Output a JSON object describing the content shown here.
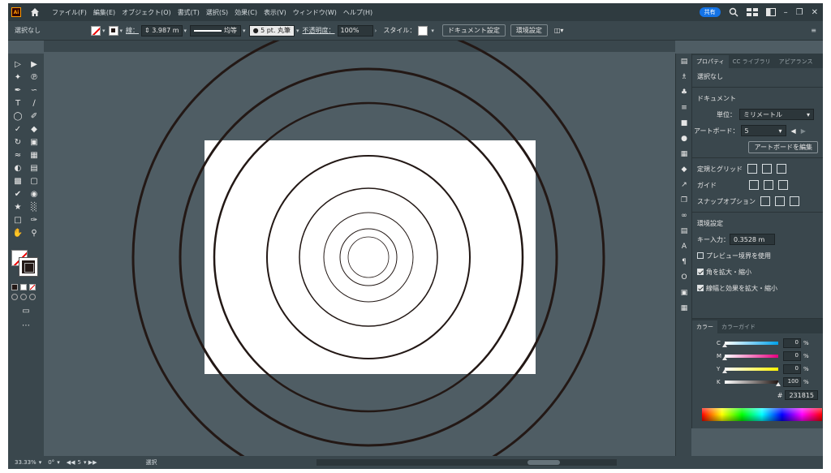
{
  "menubar": {
    "logo": "Ai",
    "items": [
      "ファイル(F)",
      "編集(E)",
      "オブジェクト(O)",
      "書式(T)",
      "選択(S)",
      "効果(C)",
      "表示(V)",
      "ウィンドウ(W)",
      "ヘルプ(H)"
    ],
    "share_label": "共有"
  },
  "controlbar": {
    "selection": "選択なし",
    "stroke_label": "線：",
    "stroke_weight": "3.987 m",
    "stroke_profile": "均等",
    "brush": "5 pt. 丸筆",
    "opacity_label": "不透明度：",
    "opacity": "100%",
    "style_label": "スタイル：",
    "doc_setup_button": "ドキュメント設定",
    "preferences_button": "環境設定"
  },
  "statusbar": {
    "zoom": "33.33%",
    "rotation": "0°",
    "artboard": "5",
    "tool": "選択"
  },
  "properties": {
    "tabs": [
      "プロパティ",
      "CC ライブラリ",
      "アピアランス"
    ],
    "selection": "選択なし",
    "document_heading": "ドキュメント",
    "units_label": "単位：",
    "units_value": "ミリメートル",
    "artboard_label": "アートボード：",
    "artboard_value": "5",
    "edit_artboards_button": "アートボードを編集",
    "rulers_grids": "定規とグリッド",
    "guides": "ガイド",
    "snap_options": "スナップオプション",
    "preferences_heading": "環境設定",
    "key_increment_label": "キー入力：",
    "key_increment_value": "0.3528 m",
    "preview_bounds": "プレビュー境界を使用",
    "scale_corners": "角を拡大・縮小",
    "scale_strokes": "線幅と効果を拡大・縮小"
  },
  "colorpanel": {
    "tabs": [
      "カラー",
      "カラーガイド"
    ],
    "channels": [
      {
        "label": "C",
        "value": "0",
        "pos": 0,
        "color": "#00a0e9"
      },
      {
        "label": "M",
        "value": "0",
        "pos": 0,
        "color": "#e4007f"
      },
      {
        "label": "Y",
        "value": "0",
        "pos": 0,
        "color": "#fff100"
      },
      {
        "label": "K",
        "value": "100",
        "pos": 100,
        "color": "#231815"
      }
    ],
    "percent": "%",
    "hex": "231815"
  },
  "colors": {
    "stroke": "#231815",
    "artboard": "#ffffff",
    "pasteboard": "#4f5d64"
  },
  "circles": {
    "center": [
      200,
      127
    ],
    "radii": [
      290,
      232,
      190,
      125,
      85,
      55,
      35,
      25
    ]
  }
}
